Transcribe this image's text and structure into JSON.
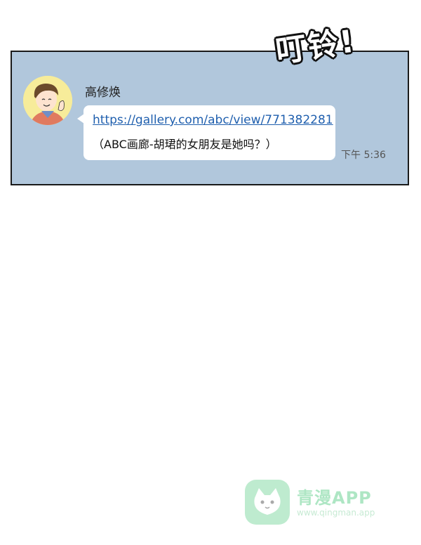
{
  "sound_effect": "叮铃!",
  "chat": {
    "sender_name": "高修焕",
    "link_text": "https://gallery.com/abc/view/771382281",
    "message_text": "（ABC画廊-胡珺的女朋友是她吗？）",
    "timestamp": "下午 5:36"
  },
  "watermark": {
    "app_name": "青漫APP",
    "url": "www.qingman.app"
  },
  "colors": {
    "panel_bg": "#b1c7dc",
    "link": "#1f5fae",
    "avatar_bg": "#f7ec9a"
  }
}
